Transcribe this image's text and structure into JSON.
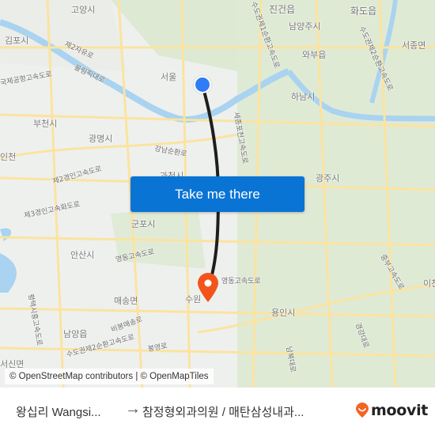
{
  "map": {
    "labels": [
      {
        "text": "고양시",
        "kind": "city"
      },
      {
        "text": "김포시",
        "kind": "city"
      },
      {
        "text": "서울",
        "kind": "city"
      },
      {
        "text": "부천시",
        "kind": "city"
      },
      {
        "text": "광명시",
        "kind": "city"
      },
      {
        "text": "인천",
        "kind": "city"
      },
      {
        "text": "과천시",
        "kind": "city"
      },
      {
        "text": "군포시",
        "kind": "city"
      },
      {
        "text": "안산시",
        "kind": "city"
      },
      {
        "text": "매송면",
        "kind": "city"
      },
      {
        "text": "남양읍",
        "kind": "city"
      },
      {
        "text": "서신면",
        "kind": "city"
      },
      {
        "text": "수원",
        "kind": "city"
      },
      {
        "text": "진건읍",
        "kind": "city"
      },
      {
        "text": "화도읍",
        "kind": "city"
      },
      {
        "text": "남양주시",
        "kind": "city"
      },
      {
        "text": "와부읍",
        "kind": "city"
      },
      {
        "text": "서종면",
        "kind": "city"
      },
      {
        "text": "하남시",
        "kind": "city"
      },
      {
        "text": "광주시",
        "kind": "city"
      },
      {
        "text": "용인시",
        "kind": "city"
      },
      {
        "text": "이천",
        "kind": "city"
      },
      {
        "text": "제2자유로",
        "kind": "road"
      },
      {
        "text": "올림픽대로",
        "kind": "road"
      },
      {
        "text": "국제공항고속도로",
        "kind": "road"
      },
      {
        "text": "강남순환로",
        "kind": "road"
      },
      {
        "text": "제2경인고속도로",
        "kind": "road"
      },
      {
        "text": "제3경인고속화도로",
        "kind": "road"
      },
      {
        "text": "영동고속도로",
        "kind": "road"
      },
      {
        "text": "평택시흥고속도로",
        "kind": "road"
      },
      {
        "text": "비봉매송로",
        "kind": "road"
      },
      {
        "text": "수도권제2순환고속도로",
        "kind": "road"
      },
      {
        "text": "봉영로",
        "kind": "road"
      },
      {
        "text": "세종포천고속도로",
        "kind": "road"
      },
      {
        "text": "수도권제1순환고속도로",
        "kind": "road"
      },
      {
        "text": "수도권제2순환고속도로",
        "kind": "road"
      },
      {
        "text": "중부고속도로",
        "kind": "road"
      },
      {
        "text": "경강대로",
        "kind": "road"
      },
      {
        "text": "남북대로",
        "kind": "road"
      }
    ],
    "attribution": "© OpenStreetMap contributors | © OpenMapTiles",
    "cta_label": "Take me there",
    "origin_marker": "origin-dot",
    "destination_marker": "destination-pin",
    "colors": {
      "route": "#1e1e1e",
      "origin": "#2f7cf6",
      "destination": "#f3541c",
      "cta": "#0a74d4",
      "water": "#a9d3f0",
      "road": "#fbe7a3",
      "green": "#d9e8cf"
    }
  },
  "footer": {
    "origin": "왕십리 Wangsi...",
    "arrow": "→",
    "destination": "참정형외과의원 / 매탄삼성내과...",
    "brand": "moovit",
    "brand_color": "#f26522"
  }
}
